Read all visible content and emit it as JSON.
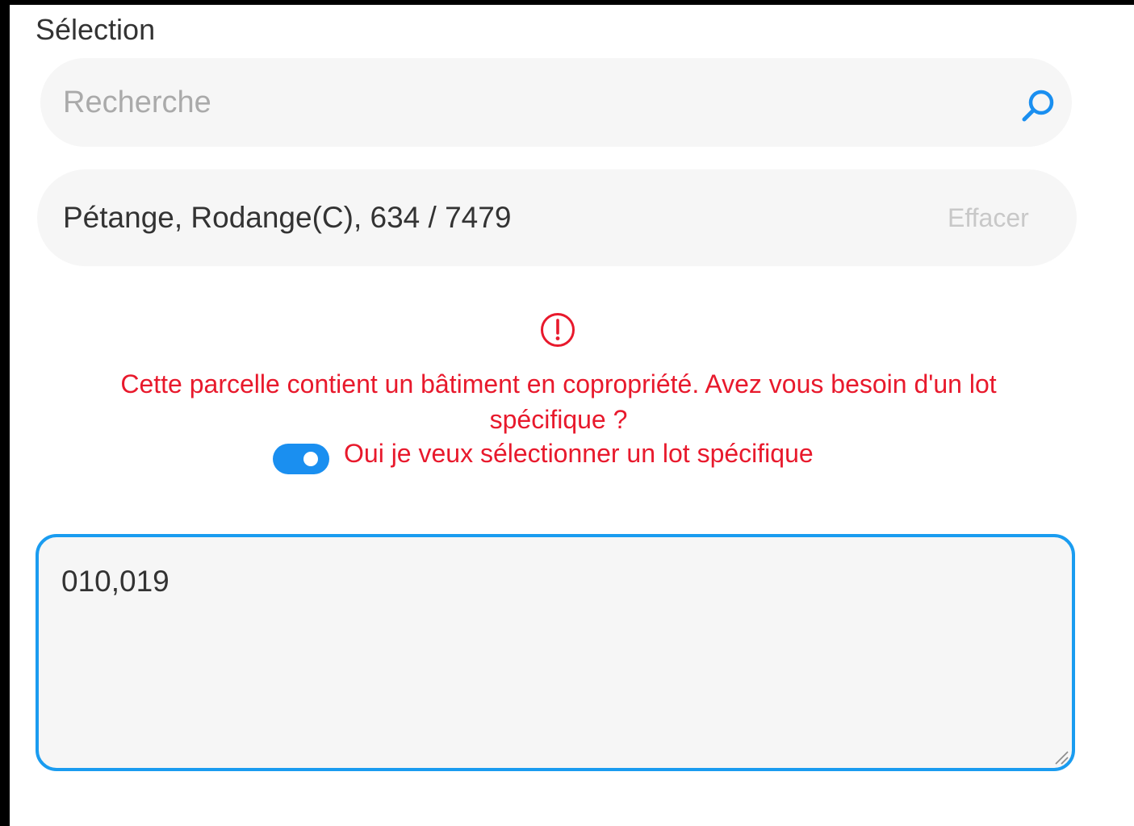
{
  "section": {
    "title": "Sélection"
  },
  "search": {
    "placeholder": "Recherche",
    "value": "",
    "icon": "search-icon"
  },
  "selection": {
    "value": "Pétange, Rodange(C), 634 / 7479",
    "clear_label": "Effacer"
  },
  "warning": {
    "icon": "warning-circle-icon",
    "message": "Cette parcelle contient un bâtiment en copropriété. Avez vous besoin d'un lot spécifique ?",
    "toggle_label": "Oui je veux sélectionner un lot spécifique",
    "toggle_on": true
  },
  "lots": {
    "value": "010,019"
  },
  "colors": {
    "accent": "#1a8ff0",
    "warning": "#e8192c",
    "field_bg": "#f6f6f6",
    "text": "#333333",
    "placeholder": "#aaaaaa"
  }
}
